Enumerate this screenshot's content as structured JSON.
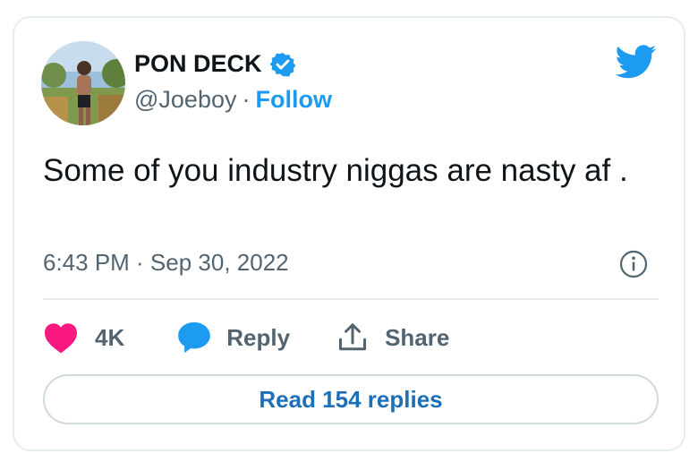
{
  "tweet": {
    "author": {
      "name": "PON DECK",
      "handle": "@Joeboy",
      "separator": "·",
      "follow_label": "Follow"
    },
    "text": "Some of you industry niggas are nasty af .",
    "timestamp": "6:43 PM · Sep 30, 2022",
    "actions": {
      "like_count": "4K",
      "reply_label": "Reply",
      "share_label": "Share"
    },
    "read_replies_label": "Read 154 replies"
  },
  "icons": {
    "logo": "twitter-bird-icon",
    "verified": "verified-badge-icon",
    "info": "info-icon",
    "like": "heart-icon",
    "reply": "speech-bubble-icon",
    "share": "share-upload-icon"
  },
  "colors": {
    "brand_blue": "#1d9bf0",
    "like_pink": "#f91880",
    "text_primary": "#0f1419",
    "text_secondary": "#536471",
    "border": "#e6ecf0"
  }
}
